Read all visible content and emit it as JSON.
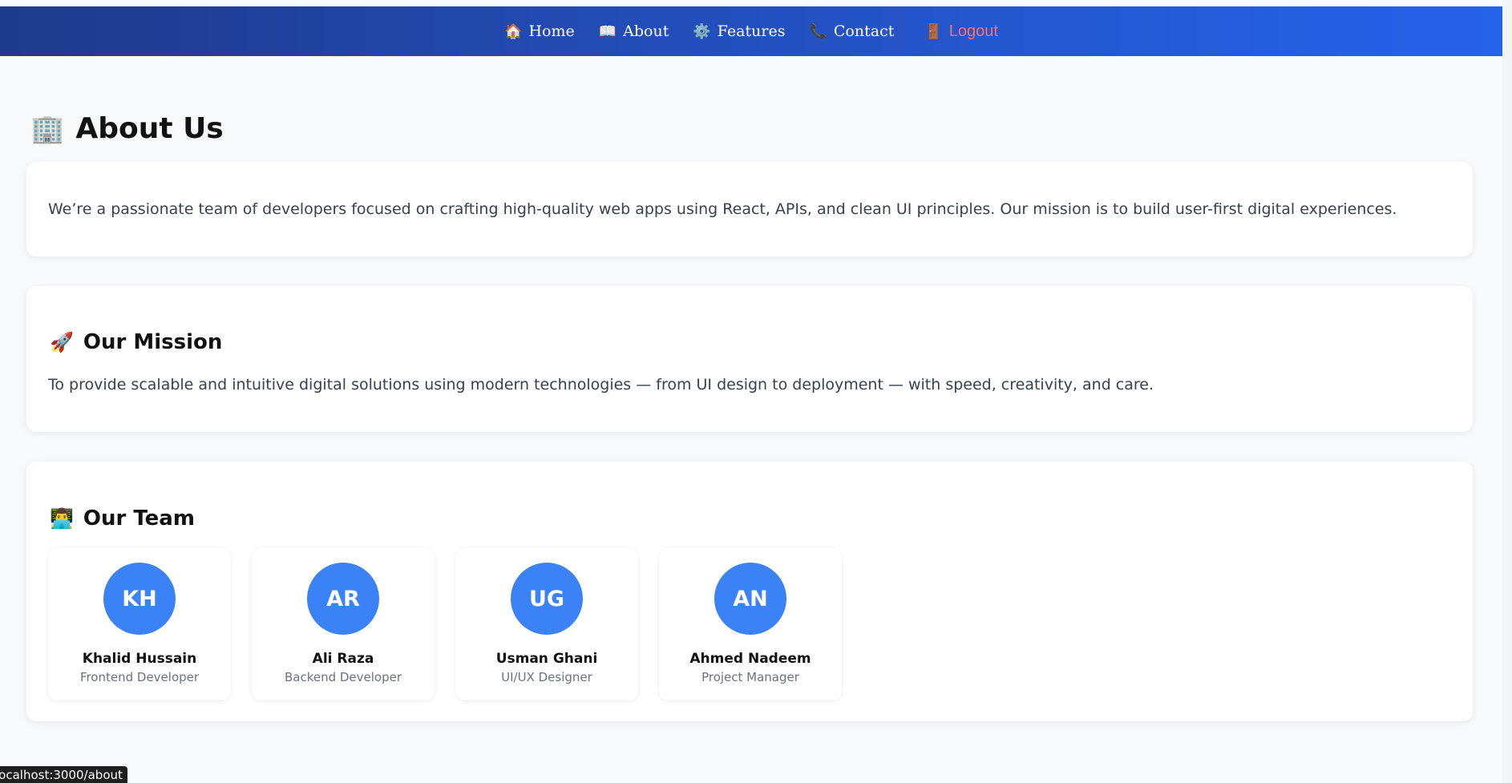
{
  "nav": {
    "items": [
      {
        "icon": "🏠",
        "icon_name": "home-icon",
        "label": "Home"
      },
      {
        "icon": "📖",
        "icon_name": "book-icon",
        "label": "About"
      },
      {
        "icon": "⚙️",
        "icon_name": "gear-icon",
        "label": "Features"
      },
      {
        "icon": "📞",
        "icon_name": "phone-icon",
        "label": "Contact"
      }
    ],
    "logout": {
      "icon": "🚪",
      "icon_name": "door-icon",
      "label": "Logout"
    },
    "gradient": [
      "#1e3a8a",
      "#2563eb"
    ]
  },
  "page": {
    "title_icon": "🏢",
    "title_icon_name": "office-building-icon",
    "title": "About Us",
    "intro": "We’re a passionate team of developers focused on crafting high-quality web apps using React, APIs, and clean UI principles. Our mission is to build user-first digital experiences."
  },
  "mission": {
    "icon": "🚀",
    "icon_name": "rocket-icon",
    "title": "Our Mission",
    "text": "To provide scalable and intuitive digital solutions using modern technologies — from UI design to deployment — with speed, creativity, and care."
  },
  "team": {
    "icon": "👨‍💻",
    "icon_name": "technologist-icon",
    "title": "Our Team",
    "avatar_color": "#3b82f6",
    "members": [
      {
        "initials": "KH",
        "name": "Khalid Hussain",
        "role": "Frontend Developer"
      },
      {
        "initials": "AR",
        "name": "Ali Raza",
        "role": "Backend Developer"
      },
      {
        "initials": "UG",
        "name": "Usman Ghani",
        "role": "UI/UX Designer"
      },
      {
        "initials": "AN",
        "name": "Ahmed Nadeem",
        "role": "Project Manager"
      }
    ]
  },
  "status_bar": {
    "url": "localhost:3000/about"
  },
  "colors": {
    "logout": "#f87171",
    "body_text": "#374151",
    "muted_text": "#6b7280",
    "page_bg": "#f8f9fb"
  }
}
